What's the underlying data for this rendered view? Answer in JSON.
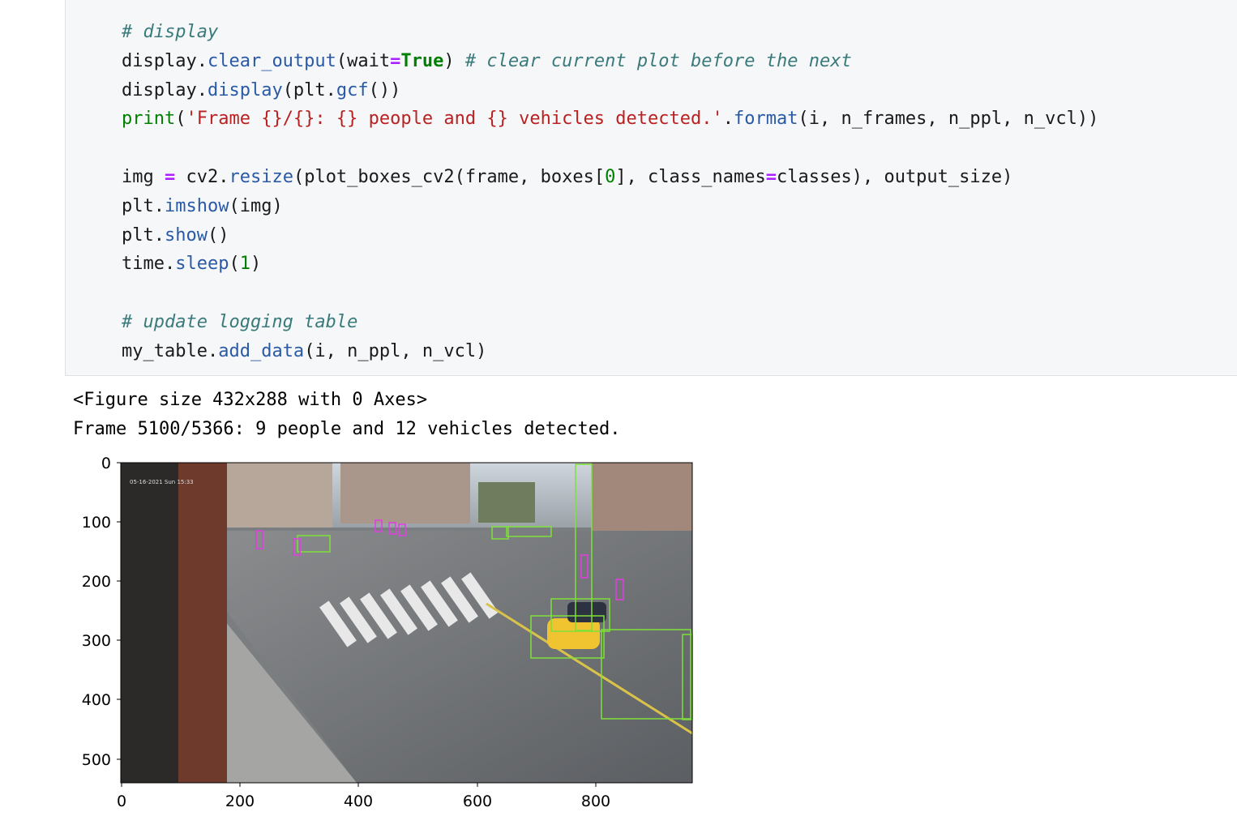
{
  "code": {
    "comment_display": "# display",
    "clear_output": {
      "obj": "display.",
      "fn": "clear_output",
      "open": "(wait",
      "eq": "=",
      "kw": "True",
      "close": ") ",
      "comment": "# clear current plot before the next"
    },
    "display_gcf": {
      "obj": "display.",
      "fn": "display",
      "arg_open": "(plt.",
      "fn2": "gcf",
      "close": "())"
    },
    "print_line": {
      "fn": "print",
      "open": "(",
      "str": "'Frame {}/{}: {} people and {} vehicles detected.'",
      "dot": ".",
      "fn2": "format",
      "args": "(i, n_frames, n_ppl, n_vcl))"
    },
    "img_line": {
      "lhs": "img ",
      "eq": "=",
      "mid": " cv2.",
      "fn": "resize",
      "a1": "(plot_boxes_cv2(frame, boxes[",
      "num": "0",
      "a2": "], class_names",
      "eq2": "=",
      "a3": "classes), output_size)"
    },
    "imshow_line": {
      "obj": "plt.",
      "fn": "imshow",
      "args": "(img)"
    },
    "show_line": {
      "obj": "plt.",
      "fn": "show",
      "args": "()"
    },
    "sleep_line": {
      "obj": "time.",
      "fn": "sleep",
      "open": "(",
      "num": "1",
      "close": ")"
    },
    "comment_update": "# update logging table",
    "add_data_line": {
      "obj": "my_table.",
      "fn": "add_data",
      "args": "(i, n_ppl, n_vcl)"
    }
  },
  "output": {
    "figure_repr": "<Figure size 432x288 with 0 Axes>",
    "frame_status": "Frame 5100/5366: 9 people and 12 vehicles detected."
  },
  "plot": {
    "yticks": [
      "0",
      "100",
      "200",
      "300",
      "400",
      "500"
    ],
    "xticks": [
      "0",
      "200",
      "400",
      "600",
      "800"
    ],
    "image_overlay_text": "05-16-2021 Sun 15:33",
    "detection_colors": {
      "person": "#e33ce3",
      "vehicle": "#7ee03a"
    }
  }
}
